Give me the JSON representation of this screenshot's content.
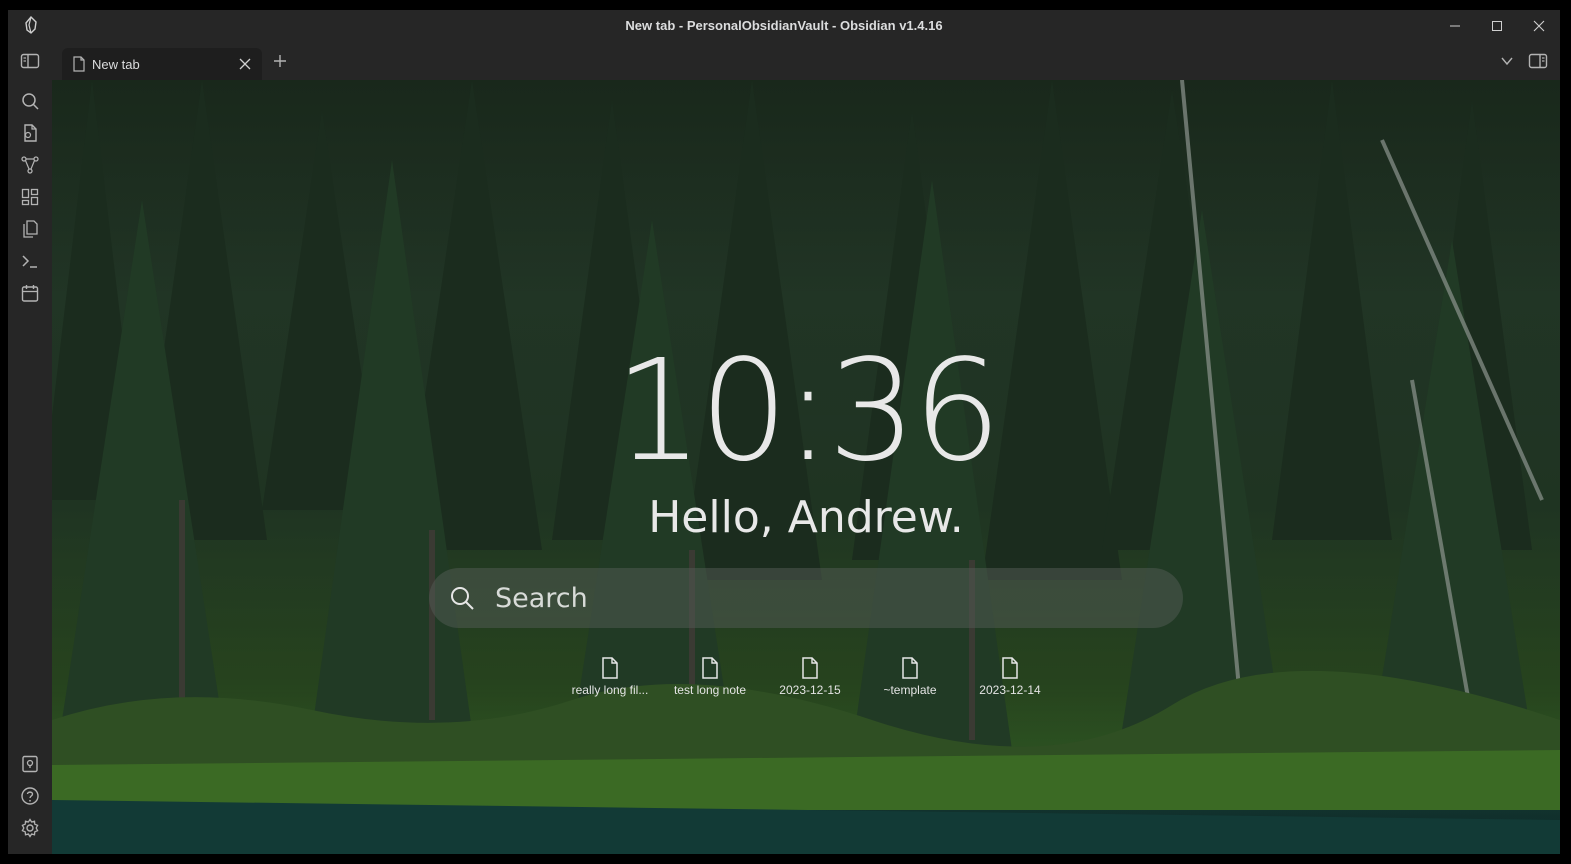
{
  "window": {
    "title": "New tab - PersonalObsidianVault - Obsidian v1.4.16"
  },
  "tabs": [
    {
      "label": "New tab",
      "active": true
    }
  ],
  "ribbon": {
    "top_icons": [
      "search-icon",
      "quick-switcher-icon",
      "graph-view-icon",
      "canvas-icon",
      "templates-icon",
      "command-palette-icon",
      "daily-note-icon"
    ],
    "bottom_icons": [
      "vault-switch-icon",
      "help-icon",
      "settings-icon"
    ]
  },
  "home": {
    "clock": "10:36",
    "greeting": "Hello, Andrew.",
    "search_placeholder": "Search",
    "recent_files": [
      {
        "name": "really long fil..."
      },
      {
        "name": "test long note"
      },
      {
        "name": "2023-12-15"
      },
      {
        "name": "~template"
      },
      {
        "name": "2023-12-14"
      }
    ]
  },
  "colors": {
    "chrome": "#262626",
    "editor_bg": "#1e1e1e",
    "text": "#dcddde",
    "icon": "#b3b3b3"
  }
}
